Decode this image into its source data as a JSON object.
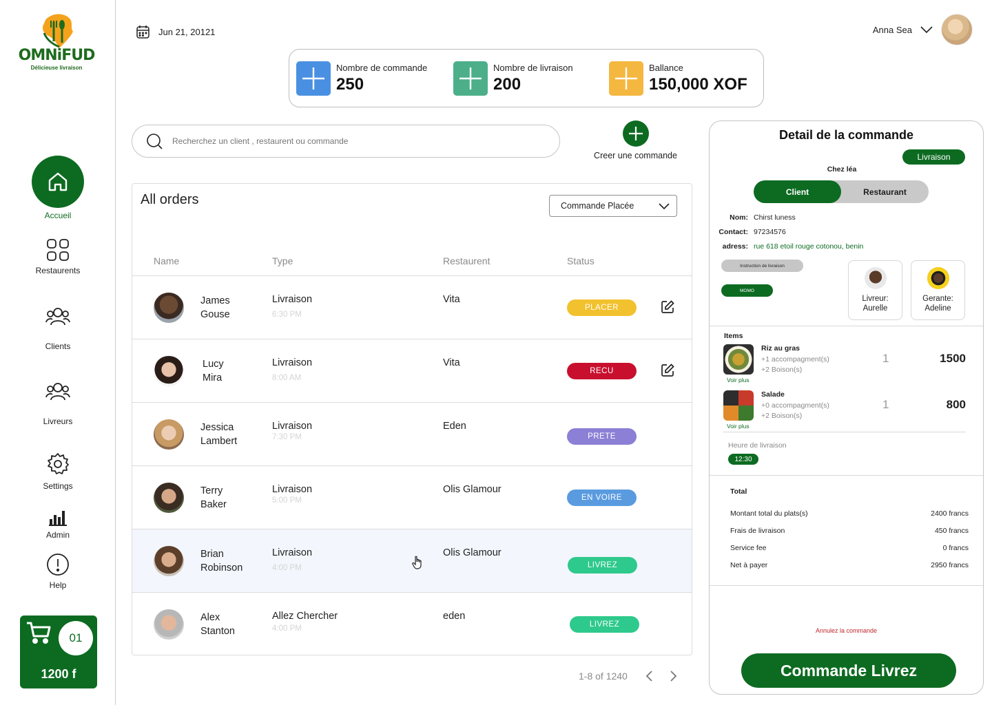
{
  "brand": {
    "name": "OMNiFUD",
    "tagline": "Délicieuse livraison"
  },
  "nav": [
    {
      "label": "Accueil",
      "icon": "home-icon"
    },
    {
      "label": "Restaurents",
      "icon": "grid-icon"
    },
    {
      "label": "Clients",
      "icon": "users-icon"
    },
    {
      "label": "Livreurs",
      "icon": "riders-icon"
    },
    {
      "label": "Settings",
      "icon": "gear-icon"
    },
    {
      "label": "Admin",
      "icon": "bar-chart-icon"
    },
    {
      "label": "Help",
      "icon": "help-icon"
    }
  ],
  "cart": {
    "count": "01",
    "total": "1200 f"
  },
  "header": {
    "date": "Jun 21, 20121",
    "user_name": "Anna Sea"
  },
  "stats": [
    {
      "label": "Nombre de commande",
      "value": "250",
      "color": "#4a90e2"
    },
    {
      "label": "Nombre de livraison",
      "value": "200",
      "color": "#4caf8a"
    },
    {
      "label": "Ballance",
      "value": "150,000 XOF",
      "color": "#f4b740"
    }
  ],
  "search": {
    "placeholder": "Recherchez un client , restaurent ou commande"
  },
  "create_label": "Creer une commande",
  "orders": {
    "title": "All orders",
    "filter": "Commande Placée",
    "columns": [
      "Name",
      "Type",
      "Restaurent",
      "Status"
    ],
    "rows": [
      {
        "first": "James",
        "last": "Gouse",
        "type": "Livraison",
        "time": "6:30 PM",
        "restaurant": "Vita",
        "status": "PLACER",
        "status_color": "#f2c12e"
      },
      {
        "first": "Lucy",
        "last": "Mira",
        "type": "Livraison",
        "time": "8:00 AM",
        "restaurant": "Vita",
        "status": "RECU",
        "status_color": "#c8102e"
      },
      {
        "first": "Jessica",
        "last": "Lambert",
        "type": "Livraison",
        "time": "7:30 PM",
        "restaurant": "Eden",
        "status": "PRETE",
        "status_color": "#8b80d6"
      },
      {
        "first": "Terry",
        "last": "Baker",
        "type": "Livraison",
        "time": "5:00 PM",
        "restaurant": "Olis Glamour",
        "status": "EN VOIRE",
        "status_color": "#5a9be0"
      },
      {
        "first": "Brian",
        "last": "Robinson",
        "type": "Livraison",
        "time": "4:00 PM",
        "restaurant": "Olis Glamour",
        "status": "LIVREZ",
        "status_color": "#2ec98c"
      },
      {
        "first": "Alex",
        "last": "Stanton",
        "type": "Allez Chercher",
        "time": "4:00 PM",
        "restaurant": "eden",
        "status": "LIVREZ",
        "status_color": "#2ec98c"
      }
    ],
    "pagination": "1-8 of 1240"
  },
  "detail": {
    "title": "Detail de la commande",
    "mode": "Livraison",
    "place": "Chez léa",
    "tabs": [
      "Client",
      "Restaurant"
    ],
    "client": {
      "nom_label": "Nom:",
      "nom": "Chirst luness",
      "contact_label": "Contact:",
      "contact": "97234576",
      "adress_label": "adress:",
      "adress": "rue 618  etoil rouge cotonou, benin"
    },
    "instruction": "Instruction de livraison",
    "payment": "MOMO",
    "livreur": {
      "role": "Livreur:",
      "name": "Aurelle"
    },
    "gerante": {
      "role": "Gerante:",
      "name": "Adeline"
    },
    "items_label": "Items",
    "items": [
      {
        "name": "Riz au gras",
        "acc": "+1 accompagment(s)",
        "drinks": "+2 Boison(s)",
        "qty": "1",
        "price": "1500",
        "more": "Voir plus"
      },
      {
        "name": "Salade",
        "acc": "+0 accompagment(s)",
        "drinks": "+2 Boison(s)",
        "qty": "1",
        "price": "800",
        "more": "Voir plus"
      }
    ],
    "heure_label": "Heure de livraison",
    "heure": "12:30",
    "total_label": "Total",
    "totals": [
      {
        "label": "Montant total du plats(s)",
        "value": "2400 francs"
      },
      {
        "label": "Frais de livraison",
        "value": "450 francs"
      },
      {
        "label": "Service fee",
        "value": "0 francs"
      },
      {
        "label": "Net à payer",
        "value": "2950 francs"
      }
    ],
    "cancel": "Annulez la commande",
    "confirm": "Commande Livrez"
  }
}
